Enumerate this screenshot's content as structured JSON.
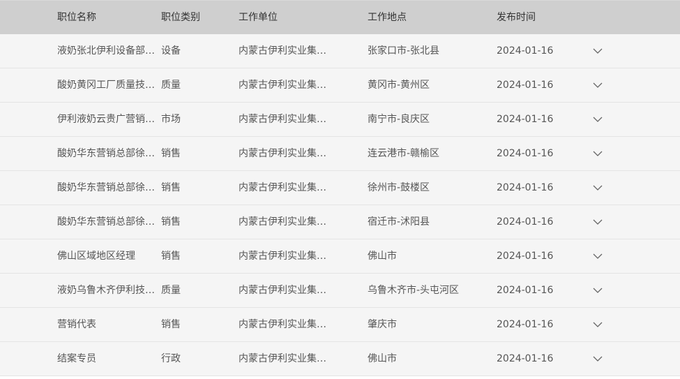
{
  "header": {
    "title": "职位名称",
    "category": "职位类别",
    "unit": "工作单位",
    "location": "工作地点",
    "date": "发布时间"
  },
  "rows": [
    {
      "title": "液奶张北伊利设备部机修工...",
      "category": "设备",
      "unit": "内蒙古伊利实业集团...",
      "location": "张家口市-张北县",
      "date": "2024-01-16"
    },
    {
      "title": "酸奶黄冈工厂质量技术部检...",
      "category": "质量",
      "unit": "内蒙古伊利实业集团...",
      "location": "黄冈市-黄州区",
      "date": "2024-01-16"
    },
    {
      "title": "伊利液奶云贵广营销总部南...",
      "category": "市场",
      "unit": "内蒙古伊利实业集团...",
      "location": "南宁市-良庆区",
      "date": "2024-01-16"
    },
    {
      "title": "酸奶华东营销总部徐州区域...",
      "category": "销售",
      "unit": "内蒙古伊利实业集团...",
      "location": "连云港市-赣榆区",
      "date": "2024-01-16"
    },
    {
      "title": "酸奶华东营销总部徐州区域...",
      "category": "销售",
      "unit": "内蒙古伊利实业集团...",
      "location": "徐州市-鼓楼区",
      "date": "2024-01-16"
    },
    {
      "title": "酸奶华东营销总部徐州区域...",
      "category": "销售",
      "unit": "内蒙古伊利实业集团...",
      "location": "宿迁市-沭阳县",
      "date": "2024-01-16"
    },
    {
      "title": "佛山区域地区经理",
      "category": "销售",
      "unit": "内蒙古伊利实业集团...",
      "location": "佛山市",
      "date": "2024-01-16"
    },
    {
      "title": "液奶乌鲁木齐伊利技术部质...",
      "category": "质量",
      "unit": "内蒙古伊利实业集团...",
      "location": "乌鲁木齐市-头屯河区",
      "date": "2024-01-16"
    },
    {
      "title": "营销代表",
      "category": "销售",
      "unit": "内蒙古伊利实业集团...",
      "location": "肇庆市",
      "date": "2024-01-16"
    },
    {
      "title": "结案专员",
      "category": "行政",
      "unit": "内蒙古伊利实业集团...",
      "location": "佛山市",
      "date": "2024-01-16"
    }
  ]
}
